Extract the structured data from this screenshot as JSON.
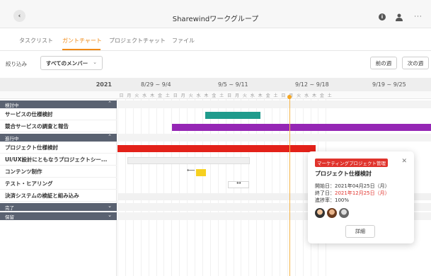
{
  "header": {
    "title": "Sharewindワークグループ",
    "back_icon": "back-icon",
    "info_icon": "info-icon",
    "user_icon": "user-icon",
    "more_icon": "more-icon"
  },
  "tabs": [
    {
      "label": "タスクリスト",
      "active": false
    },
    {
      "label": "ガントチャート",
      "active": true
    },
    {
      "label": "プロジェクトチャット",
      "active": false
    },
    {
      "label": "ファイル",
      "active": false
    }
  ],
  "toolbar": {
    "filter_label": "絞り込み",
    "member_select": "すべてのメンバー",
    "prev_week": "前の週",
    "next_week": "次の週"
  },
  "timeline": {
    "year": "2021",
    "weeks": [
      "8/29 ~ 9/4",
      "9/5 ~ 9/11",
      "9/12 ~ 9/18",
      "9/19 ~ 9/25"
    ],
    "days": [
      "日",
      "月",
      "火",
      "水",
      "木",
      "金",
      "土",
      "日",
      "月",
      "火",
      "水",
      "木",
      "金",
      "土",
      "日",
      "月",
      "火",
      "水",
      "木",
      "金",
      "土",
      "日",
      "月",
      "火",
      "水",
      "木",
      "金",
      "土"
    ]
  },
  "groups": {
    "review": "検討中",
    "active": "進行中",
    "done": "完了",
    "hold": "保留"
  },
  "tasks": [
    {
      "name": "サービスの仕様検討",
      "group": "検討中",
      "color": "#1f9b8c"
    },
    {
      "name": "競合サービスの調査と報告",
      "group": "検討中",
      "color": "#9526b5"
    },
    {
      "name": "プロジェクト仕様検討",
      "group": "進行中",
      "color": "#e32119"
    },
    {
      "name": "UI/UX設計にともなうプロジェクトシー...",
      "group": "進行中",
      "color": "#eeeeee"
    },
    {
      "name": "コンテンツ制作",
      "group": "進行中",
      "color": "#f6d020"
    },
    {
      "name": "テスト・ヒアリング",
      "group": "進行中",
      "color": "#eeeeee"
    },
    {
      "name": "決済システムの検証と組み込み",
      "group": "進行中",
      "color": "#eeeeee"
    }
  ],
  "popup": {
    "project_badge": "マーケティングプロジェクト管理",
    "title": "プロジェクト仕様検討",
    "start": "開始日：2021年04月25日（月）",
    "end_label": "終了日：",
    "end_value": "2021年12月25日（月）",
    "progress": "進捗率：100%",
    "detail_button": "詳細",
    "close_icon": "close-icon"
  },
  "colors": {
    "accent": "#f08a16",
    "group_header": "#5a6271",
    "today_line": "#f5b54a"
  }
}
